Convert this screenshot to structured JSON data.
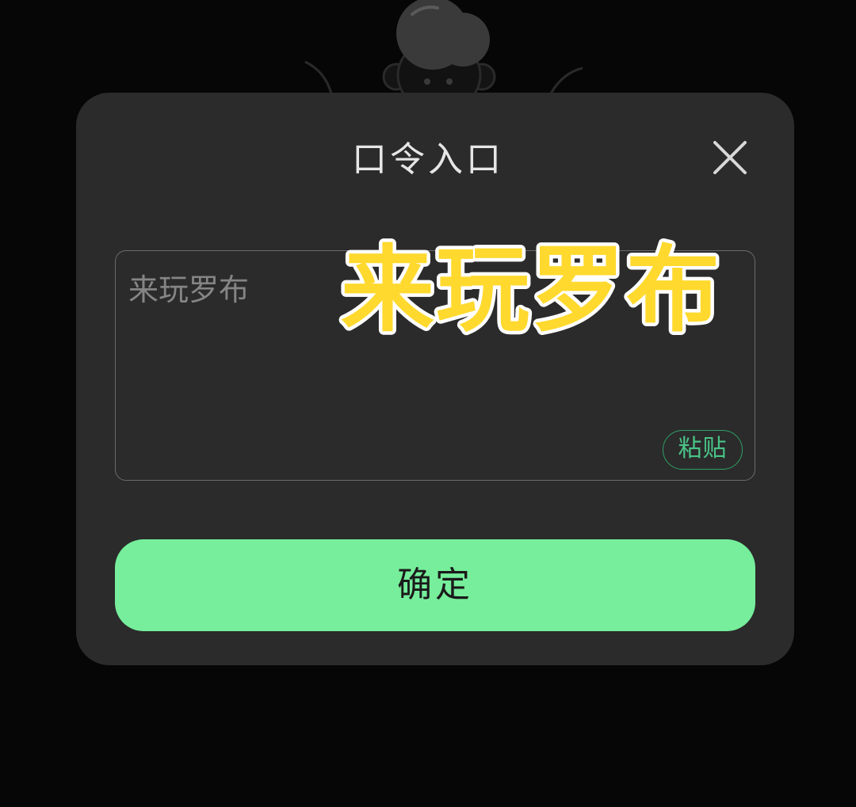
{
  "dialog": {
    "title": "口令入口",
    "close_icon": "close-icon",
    "input": {
      "value": "",
      "placeholder": "来玩罗布"
    },
    "paste_label": "粘贴",
    "confirm_label": "确定"
  },
  "overlay": {
    "caption": "来玩罗布"
  },
  "colors": {
    "dialog_bg": "#2b2b2b",
    "accent_green": "#76ee9b",
    "paste_green": "#49c487",
    "caption_yellow": "#ffd92e"
  },
  "mascot_icon": "mascot-peeking-icon"
}
